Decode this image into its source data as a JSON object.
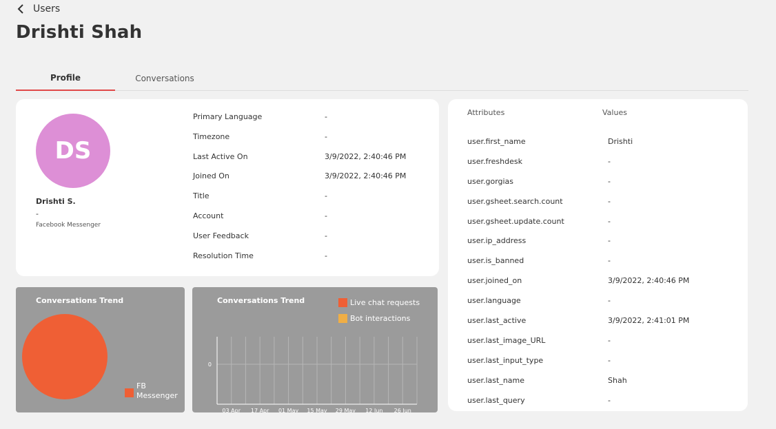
{
  "header": {
    "back_label": "Users",
    "title": "Drishti Shah"
  },
  "tabs": [
    {
      "label": "Profile"
    },
    {
      "label": "Conversations"
    }
  ],
  "profile": {
    "initials": "DS",
    "name": "Drishti S.",
    "subtitle": "-",
    "channel": "Facebook Messenger",
    "fields": [
      {
        "label": "Primary Language",
        "value": "-"
      },
      {
        "label": "Timezone",
        "value": "-"
      },
      {
        "label": "Last Active On",
        "value": "3/9/2022, 2:40:46 PM"
      },
      {
        "label": "Joined On",
        "value": "3/9/2022, 2:40:46 PM"
      },
      {
        "label": "Title",
        "value": "-"
      },
      {
        "label": "Account",
        "value": "-"
      },
      {
        "label": "User Feedback",
        "value": "-"
      },
      {
        "label": "Resolution Time",
        "value": "-"
      }
    ]
  },
  "attributes": {
    "header_key": "Attributes",
    "header_value": "Values",
    "rows": [
      {
        "key": "user.first_name",
        "value": "Drishti"
      },
      {
        "key": "user.freshdesk",
        "value": "-"
      },
      {
        "key": "user.gorgias",
        "value": "-"
      },
      {
        "key": "user.gsheet.search.count",
        "value": "-"
      },
      {
        "key": "user.gsheet.update.count",
        "value": "-"
      },
      {
        "key": "user.ip_address",
        "value": "-"
      },
      {
        "key": "user.is_banned",
        "value": "-"
      },
      {
        "key": "user.joined_on",
        "value": "3/9/2022, 2:40:46 PM"
      },
      {
        "key": "user.language",
        "value": "-"
      },
      {
        "key": "user.last_active",
        "value": "3/9/2022, 2:41:01 PM"
      },
      {
        "key": "user.last_image_URL",
        "value": "-"
      },
      {
        "key": "user.last_input_type",
        "value": "-"
      },
      {
        "key": "user.last_name",
        "value": "Shah"
      },
      {
        "key": "user.last_query",
        "value": "-"
      }
    ]
  },
  "colors": {
    "accent": "#e04848",
    "avatar": "#dd8fd6",
    "live_chat": "#ef5f35",
    "bot": "#f0ae45"
  },
  "chart_data": [
    {
      "type": "pie",
      "title": "Conversations Trend",
      "categories": [
        "FB Messenger"
      ],
      "values": [
        1
      ],
      "colors": [
        "#ef5f35"
      ],
      "legend": "bottom-right"
    },
    {
      "type": "line",
      "title": "Conversations Trend",
      "x": [
        "03 Apr",
        "17 Apr",
        "01 May",
        "15 May",
        "29 May",
        "12 Jun",
        "26 Jun"
      ],
      "y_ticks": [
        "0"
      ],
      "series": [
        {
          "name": "Live chat requests",
          "color": "#ef5f35",
          "values": [
            0,
            0,
            0,
            0,
            0,
            0,
            0
          ]
        },
        {
          "name": "Bot interactions",
          "color": "#f0ae45",
          "values": [
            0,
            0,
            0,
            0,
            0,
            0,
            0
          ]
        }
      ],
      "grid": true,
      "legend": "top-right"
    }
  ]
}
